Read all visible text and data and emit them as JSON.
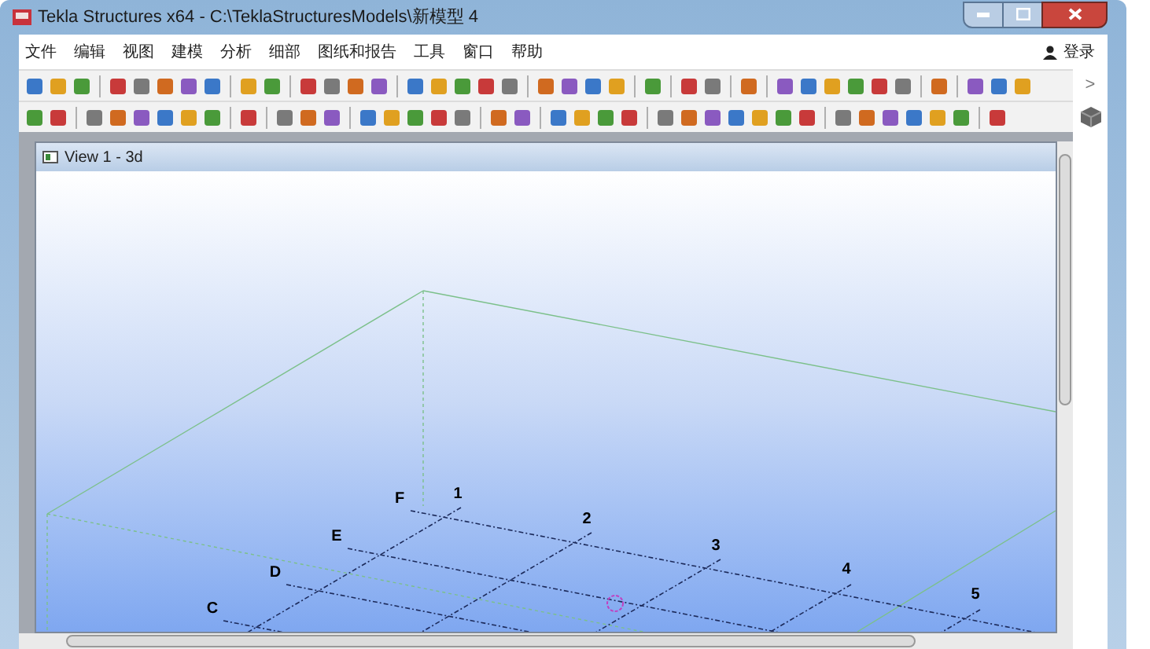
{
  "window": {
    "title": "Tekla Structures x64 - C:\\TeklaStructuresModels\\新模型 4"
  },
  "menu": [
    "文件",
    "编辑",
    "视图",
    "建模",
    "分析",
    "细部",
    "图纸和报告",
    "工具",
    "窗口",
    "帮助"
  ],
  "login": {
    "label": "登录"
  },
  "toolbar_overflow": ">",
  "view": {
    "title": "View 1 - 3d",
    "grid_letters": [
      "F",
      "E",
      "D",
      "C"
    ],
    "grid_numbers": [
      "1",
      "2",
      "3",
      "4",
      "5"
    ]
  }
}
